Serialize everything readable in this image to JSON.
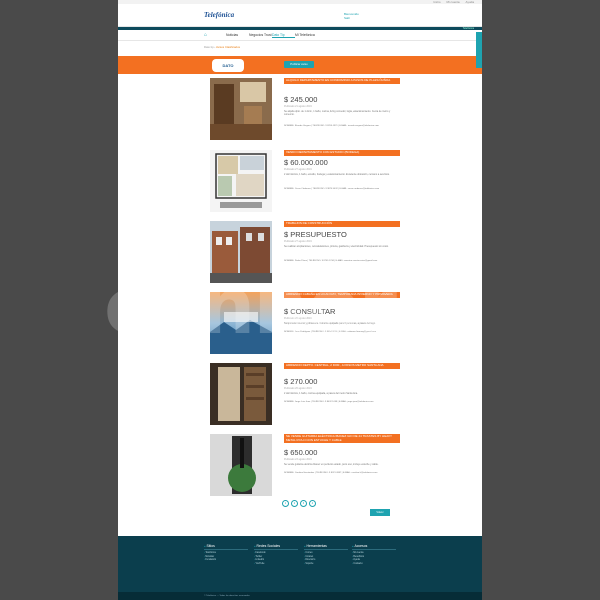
{
  "topbar": {
    "links": [
      "Inicio",
      "Mi cuenta",
      "Ayuda"
    ]
  },
  "header": {
    "logo": "Telefónica",
    "logo_sub": "",
    "user_line1": "Bienvenido",
    "user_line2": "Salir"
  },
  "strip": {
    "text": "Telefónica"
  },
  "nav": {
    "home_icon": "home-icon",
    "items": [
      "Noticias",
      "Negocios Trust",
      "Dato Tip",
      "Mi Telefónica"
    ]
  },
  "breadcrumb": {
    "root": "Dato tip",
    "current": "Avisos Clasificados"
  },
  "banner": {
    "badge": "DATO",
    "publish_label": "Publicar aviso",
    "color": "#f37021"
  },
  "listings": [
    {
      "title": "ALQUILO DEPARTAMENTO EN CONDOMINIO A PASOS DE PLAZA ÑUÑOA",
      "price": "$ 245.000",
      "date": "Publicado 21 agosto 2019",
      "desc": "Se alquila dpto. de 1 dorm, 1 baño, cocina, living comedor, logia, estacionamiento. Cerca de metro y comercio.",
      "contact": "NOMBRE: Ricardo Vergara | TELÉFONO: 9 8765 4321 | E-MAIL: ricardo.vergara@telefonica.com"
    },
    {
      "title": "VENDO DEPARTAMENTO CON ESTUDIO (BODEGA)",
      "price": "$ 60.000.000",
      "date": "Publicado 27 agosto 2019",
      "desc": "2 dormitorios, 1 baño, estudio, bodega y estacionamiento. Excelente ubicación, cercano a servicios.",
      "contact": "NOMBRE: Cesar Cárdenas | TELÉFONO: 9 9876 5432 | E-MAIL: cesar.cardenas@telefonica.com"
    },
    {
      "title": "TRABAJOS DE CONSTRUCCIÓN",
      "price": "$ PRESUPUESTO",
      "date": "Publicado 27 agosto 2019",
      "desc": "Se realizan ampliaciones, remodelaciones, pintura, gasfitería y electricidad. Presupuesto sin costo.",
      "contact": "NOMBRE: Pedro Pérez | TELÉFONO: 9 8765 1234 | E-MAIL: maestro.construccion@gmail.com"
    },
    {
      "title": "ARRIENDO CABAÑA EN LICAN RAY, TEMPORADA INVIERNO Y PRIMAVERA",
      "price": "$ CONSULTAR",
      "date": "Publicado 26 agosto 2019",
      "desc": "Temporada invierno y primavera. Cabaña equipada para 6 personas, a pasos del lago.",
      "contact": "NOMBRE: Juan Rodríguez | TELÉFONO: 9 8654 3210 | E-MAIL: cabanas.licanray@gmail.com"
    },
    {
      "title": "ARRIENDO DEPTO. CENTRAL, 2 DOR., A PASOS METRO SANTA ANA",
      "price": "$ 270.000",
      "date": "Publicado 26 agosto 2019",
      "desc": "2 dormitorios, 1 baño, cocina equipada, a pasos del metro Santa Ana.",
      "contact": "NOMBRE: Jorge Luis Juan | TELÉFONO: 9 8432 1098 | E-MAIL: jorge.juan@telefonica.com"
    },
    {
      "title": "SE VENDE GUITARRA ELÉCTRICA IBANEZ GIO DE 24 TRASTES BY HEAVY METAL RYA-N CON ESTUCHE Y CABLE",
      "price": "$ 650.000",
      "date": "Publicado 23 agosto 2019",
      "desc": "Se vende guitarra eléctrica Ibanez en perfecto estado, poco uso, incluye estuche y cable.",
      "contact": "NOMBRE: Carolina Hernández | TELÉFONO: 9 8321 0987 | E-MAIL: carolina.h@telefonica.com"
    }
  ],
  "pager": {
    "pages": [
      "1",
      "2",
      "3",
      "4"
    ]
  },
  "back_label": "Volver",
  "footer": {
    "columns": [
      {
        "title": "Sitios",
        "links": [
          "Telefónica",
          "Movistar",
          "Fundación"
        ]
      },
      {
        "title": "Redes Sociales",
        "links": [
          "Facebook",
          "Twitter",
          "LinkedIn",
          "YouTube"
        ]
      },
      {
        "title": "Herramientas",
        "links": [
          "Correo",
          "Intranet",
          "Directorio",
          "Soporte"
        ]
      },
      {
        "title": "Accesos",
        "links": [
          "Mi cuenta",
          "Beneficios",
          "Ayuda",
          "Contacto"
        ]
      }
    ],
    "bottom": "© Telefónica — Todos los derechos reservados"
  },
  "watermark": "connora"
}
